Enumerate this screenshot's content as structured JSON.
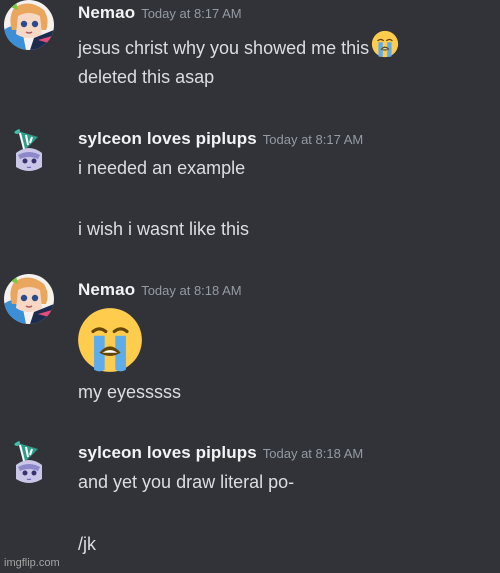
{
  "messages": [
    {
      "username": "Nemao",
      "timestamp": "Today at 8:17 AM",
      "avatar": "anime-character-avatar",
      "lines": [
        "jesus christ why you showed me this",
        "deleted this asap"
      ],
      "emoji": "loudly-crying-face"
    },
    {
      "username": "sylceon loves piplups",
      "timestamp": "Today at 8:17 AM",
      "avatar": "party-hat-character-avatar",
      "lines": [
        "i needed an example",
        "i wish i wasnt like this"
      ]
    },
    {
      "username": "Nemao",
      "timestamp": "Today at 8:18 AM",
      "avatar": "anime-character-avatar",
      "emoji": "loudly-crying-face",
      "lines": [
        "my eyesssss"
      ]
    },
    {
      "username": "sylceon loves piplups",
      "timestamp": "Today at 8:18 AM",
      "avatar": "party-hat-character-avatar",
      "lines": [
        "and yet you draw literal po-",
        "/jk"
      ]
    }
  ],
  "watermark": "imgflip.com",
  "colors": {
    "background": "#313338",
    "username": "#f2f3f5",
    "timestamp": "#949ba4",
    "message_text": "#dbdee1"
  }
}
